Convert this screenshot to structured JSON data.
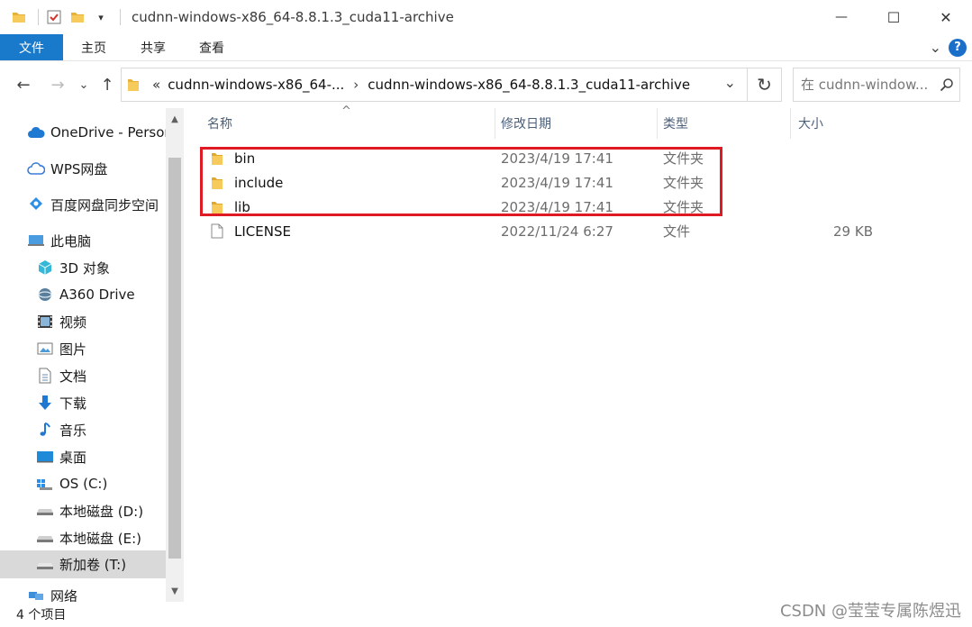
{
  "window": {
    "title": "cudnn-windows-x86_64-8.8.1.3_cuda11-archive",
    "minimize_glyph": "—",
    "maximize_glyph": "☐",
    "close_glyph": "✕"
  },
  "ribbon": {
    "tabs": [
      {
        "label": "文件",
        "active": true
      },
      {
        "label": "主页"
      },
      {
        "label": "共享"
      },
      {
        "label": "查看"
      }
    ],
    "expand_glyph": "⌄",
    "help_label": "?"
  },
  "address": {
    "prefix_glyph": "«",
    "crumbs": [
      "cudnn-windows-x86_64-...",
      "cudnn-windows-x86_64-8.8.1.3_cuda11-archive"
    ],
    "separator_glyph": "›",
    "dropdown_glyph": "⌄",
    "refresh_glyph": "↻"
  },
  "search": {
    "placeholder": "在 cudnn-window..."
  },
  "nav": {
    "back_glyph": "←",
    "forward_glyph": "→",
    "recent_glyph": "⌄",
    "up_glyph": "↑",
    "items": [
      {
        "label": "OneDrive - Person",
        "icon": "cloud-icon"
      },
      {
        "label": "WPS网盘",
        "icon": "wps-cloud-icon"
      },
      {
        "label": "百度网盘同步空间",
        "icon": "baidu-sync-icon"
      },
      {
        "label": "此电脑",
        "icon": "pc-icon"
      },
      {
        "label": "3D 对象",
        "icon": "3d-objects-icon"
      },
      {
        "label": "A360 Drive",
        "icon": "a360-icon"
      },
      {
        "label": "视频",
        "icon": "video-icon"
      },
      {
        "label": "图片",
        "icon": "pictures-icon"
      },
      {
        "label": "文档",
        "icon": "documents-icon"
      },
      {
        "label": "下载",
        "icon": "download-icon"
      },
      {
        "label": "音乐",
        "icon": "music-icon"
      },
      {
        "label": "桌面",
        "icon": "desktop-icon"
      },
      {
        "label": "OS (C:)",
        "icon": "os-drive-icon"
      },
      {
        "label": "本地磁盘 (D:)",
        "icon": "drive-icon"
      },
      {
        "label": "本地磁盘 (E:)",
        "icon": "drive-icon"
      },
      {
        "label": "新加卷 (T:)",
        "icon": "drive-icon",
        "selected": true
      },
      {
        "label": "网络",
        "icon": "network-icon"
      }
    ],
    "scroll_up_glyph": "▲",
    "scroll_down_glyph": "▼"
  },
  "columns": {
    "name": "名称",
    "date": "修改日期",
    "type": "类型",
    "size": "大小",
    "sort_glyph": "^"
  },
  "files": [
    {
      "name": "bin",
      "date": "2023/4/19 17:41",
      "type": "文件夹",
      "size": "",
      "kind": "folder"
    },
    {
      "name": "include",
      "date": "2023/4/19 17:41",
      "type": "文件夹",
      "size": "",
      "kind": "folder"
    },
    {
      "name": "lib",
      "date": "2023/4/19 17:41",
      "type": "文件夹",
      "size": "",
      "kind": "folder"
    },
    {
      "name": "LICENSE",
      "date": "2022/11/24 6:27",
      "type": "文件",
      "size": "29 KB",
      "kind": "file"
    }
  ],
  "status": {
    "count": "4 个项目"
  },
  "watermark": "CSDN @莹莹专属陈煜迅",
  "colors": {
    "accent": "#1979ca",
    "highlight_box": "#e01a22",
    "folder": "#f2c94c"
  }
}
